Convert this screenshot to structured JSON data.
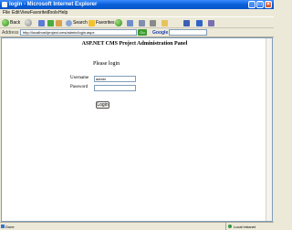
{
  "window": {
    "title": "login - Microsoft Internet Explorer",
    "controls": [
      "minimize",
      "maximize",
      "close"
    ]
  },
  "menu": [
    "File",
    "Edit",
    "View",
    "Favorites",
    "Tools",
    "Help"
  ],
  "toolbar": {
    "back_label": "Back",
    "search_label": "Search",
    "favorites_label": "Favorites"
  },
  "address": {
    "label": "Address",
    "url": "http://localhost/project.cms/admin/login.aspx",
    "go_label": "Go"
  },
  "google": {
    "label": "Google"
  },
  "page": {
    "title": "ASP.NET CMS Project Administration Panel",
    "prompt": "Please login",
    "username_label": "Username",
    "username_value": "admin",
    "password_label": "Password",
    "password_value": "",
    "login_button": "Login"
  },
  "status": {
    "text": "Done",
    "zone": "Local intranet"
  }
}
